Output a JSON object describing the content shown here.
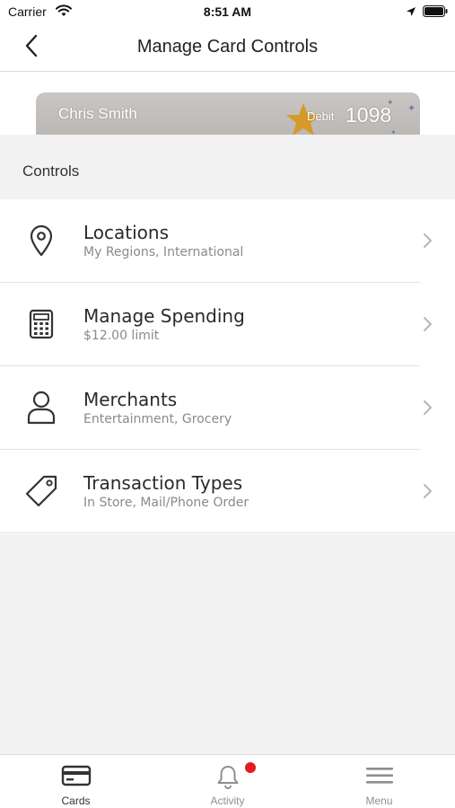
{
  "status_bar": {
    "carrier": "Carrier",
    "time": "8:51 AM",
    "icons": [
      "wifi-icon",
      "location-arrow-icon",
      "battery-icon"
    ]
  },
  "header": {
    "title": "Manage Card Controls",
    "back_icon": "chevron-left-icon"
  },
  "card": {
    "holder_name": "Chris Smith",
    "type": "Debit",
    "last4": "1098",
    "logo_icon": "star-icon"
  },
  "controls": {
    "section_title": "Controls",
    "items": [
      {
        "title": "Locations",
        "subtitle": "My Regions, International",
        "icon": "location-pin-icon"
      },
      {
        "title": "Manage Spending",
        "subtitle": "$12.00 limit",
        "icon": "calculator-icon"
      },
      {
        "title": "Merchants",
        "subtitle": "Entertainment, Grocery",
        "icon": "person-icon"
      },
      {
        "title": "Transaction Types",
        "subtitle": "In Store, Mail/Phone Order",
        "icon": "tag-icon"
      }
    ]
  },
  "tab_bar": {
    "tabs": [
      {
        "label": "Cards",
        "icon": "card-icon",
        "active": true
      },
      {
        "label": "Activity",
        "icon": "bell-icon",
        "active": false,
        "has_notification": true
      },
      {
        "label": "Menu",
        "icon": "hamburger-icon",
        "active": false
      }
    ]
  },
  "colors": {
    "notification": "#e31b23",
    "card_star": "#d69a2a",
    "background": "#f2f2f2"
  }
}
